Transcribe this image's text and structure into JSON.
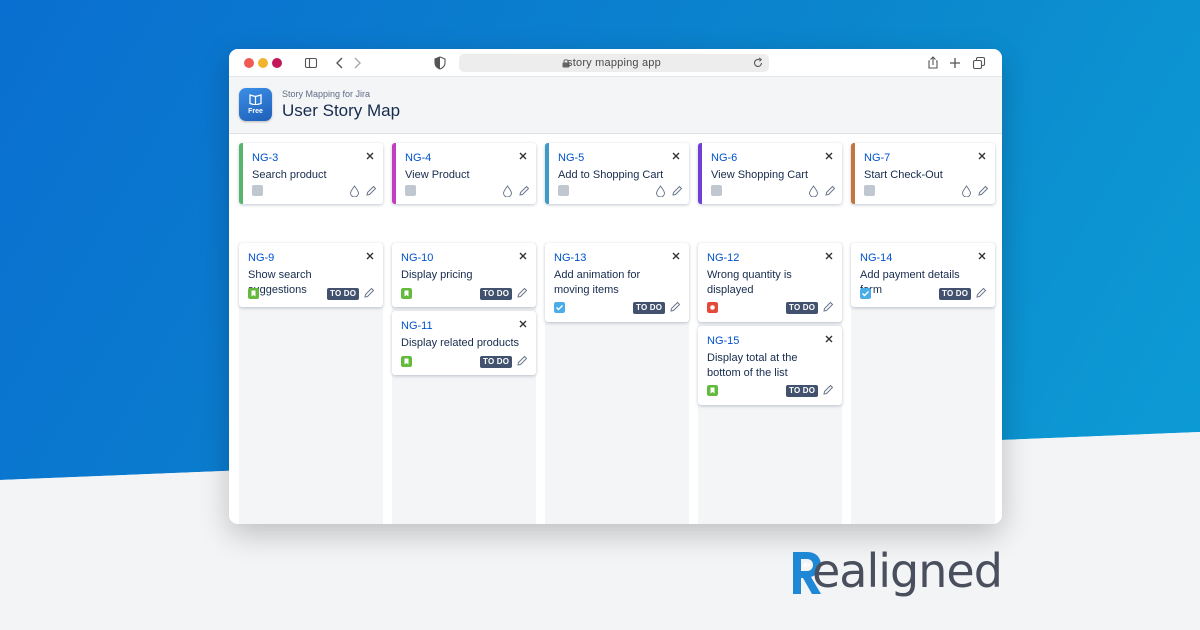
{
  "browser": {
    "url": "story mapping app"
  },
  "app": {
    "subtitle": "Story Mapping for Jira",
    "title": "User Story Map",
    "logo_badge": "Free"
  },
  "epics": [
    {
      "key": "NG-3",
      "title": "Search product",
      "color": "#57b56e"
    },
    {
      "key": "NG-4",
      "title": "View Product",
      "color": "#c13fc0"
    },
    {
      "key": "NG-5",
      "title": "Add to Shopping Cart",
      "color": "#3e9ac6"
    },
    {
      "key": "NG-6",
      "title": "View Shopping Cart",
      "color": "#6f3fd8"
    },
    {
      "key": "NG-7",
      "title": "Start Check-Out",
      "color": "#c4743c"
    }
  ],
  "stories": [
    {
      "key": "NG-9",
      "title": "Show search suggestions",
      "status": "TO DO",
      "type": "story"
    },
    {
      "key": "NG-10",
      "title": "Display pricing",
      "status": "TO DO",
      "type": "story"
    },
    {
      "key": "NG-11",
      "title": "Display related products",
      "status": "TO DO",
      "type": "story"
    },
    {
      "key": "NG-13",
      "title": "Add animation for moving items",
      "status": "TO DO",
      "type": "task"
    },
    {
      "key": "NG-12",
      "title": "Wrong quantity is displayed",
      "status": "TO DO",
      "type": "bug"
    },
    {
      "key": "NG-15",
      "title": "Display total at the bottom of the list",
      "status": "TO DO",
      "type": "story"
    },
    {
      "key": "NG-14",
      "title": "Add payment details form",
      "status": "TO DO",
      "type": "task"
    }
  ],
  "brand": {
    "name": "Realigned",
    "text_rest": "ealigned",
    "color": "#1e88d6"
  }
}
